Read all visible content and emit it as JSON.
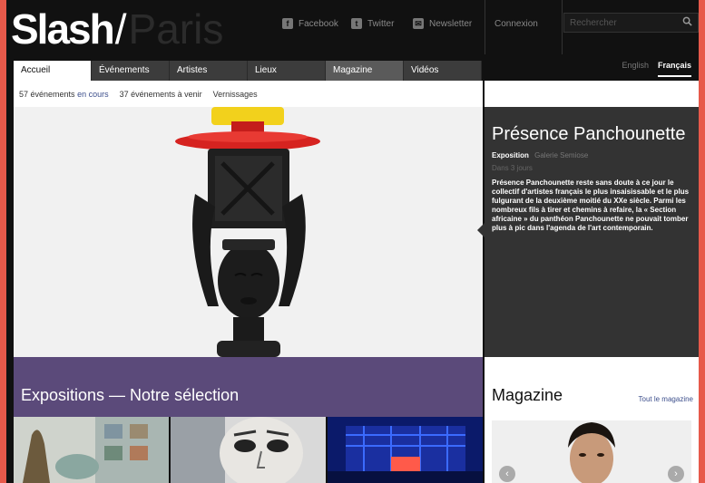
{
  "header": {
    "logo_main": "Slash",
    "logo_slash": "/",
    "logo_city": "Paris",
    "social": [
      {
        "label": "Facebook",
        "icon": "facebook-icon"
      },
      {
        "label": "Twitter",
        "icon": "twitter-icon"
      },
      {
        "label": "Newsletter",
        "icon": "newsletter-icon"
      }
    ],
    "connexion": "Connexion",
    "search_placeholder": "Rechercher"
  },
  "nav": {
    "tabs": [
      "Accueil",
      "Événements",
      "Artistes",
      "Lieux",
      "Magazine",
      "Vidéos"
    ]
  },
  "lang": {
    "en": "English",
    "fr": "Français"
  },
  "subbar": {
    "current_count": "57 événements",
    "current_suffix": "en cours",
    "upcoming": "37 événements à venir",
    "vernissages": "Vernissages"
  },
  "featured": {
    "title": "Présence Panchounette",
    "kind": "Exposition",
    "venue": "Galerie Semiose",
    "when": "Dans 3 jours",
    "description": "Présence Panchounette reste sans doute à ce jour le collectif d'artistes français le plus insaisissable et le plus fulgurant de la deuxième moitié du XXe siècle. Parmi les nombreux fils à tirer et chemins à refaire, la « Section africaine » du panthéon Panchounette ne pouvait tomber plus à pic dans l'agenda de l'art contemporain."
  },
  "expositions": {
    "title": "Expositions — Notre sélection"
  },
  "magazine": {
    "title": "Magazine",
    "all_link": "Tout le magazine",
    "prev": "‹",
    "next": "›"
  },
  "colors": {
    "accent_purple": "#5b4a7a",
    "link_blue": "#3d4f8c",
    "frame": "#e7594a"
  }
}
